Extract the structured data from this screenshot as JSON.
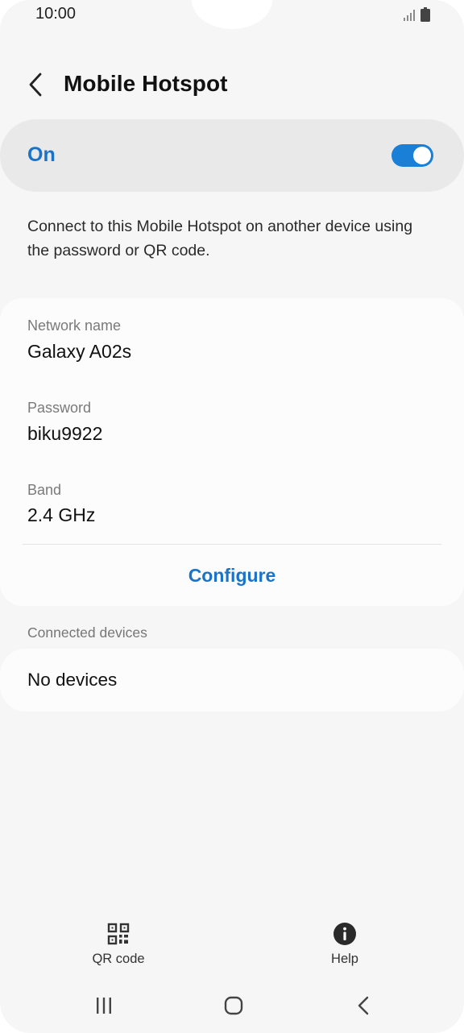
{
  "status_bar": {
    "time": "10:00",
    "icons": [
      "signal-icon",
      "battery-icon"
    ]
  },
  "header": {
    "back_icon": "chevron-left-icon",
    "title": "Mobile Hotspot"
  },
  "toggle": {
    "label": "On",
    "state": "on",
    "accent_color": "#1a7fd6"
  },
  "description": "Connect to this Mobile Hotspot on another device using the password or QR code.",
  "details": {
    "network_name_label": "Network name",
    "network_name_value": "Galaxy A02s",
    "password_label": "Password",
    "password_value": "biku9922",
    "band_label": "Band",
    "band_value": "2.4 GHz",
    "configure_label": "Configure"
  },
  "connected_devices": {
    "header": "Connected devices",
    "empty_text": "No devices"
  },
  "bottom_actions": {
    "qr_label": "QR code",
    "qr_icon": "qr-code-icon",
    "help_label": "Help",
    "help_icon": "info-icon"
  },
  "nav_bar": {
    "recents_icon": "recents-icon",
    "home_icon": "home-icon",
    "back_icon": "back-nav-icon"
  },
  "colors": {
    "accent": "#1a73c8",
    "background": "#f6f6f6",
    "card": "#fcfcfc"
  }
}
